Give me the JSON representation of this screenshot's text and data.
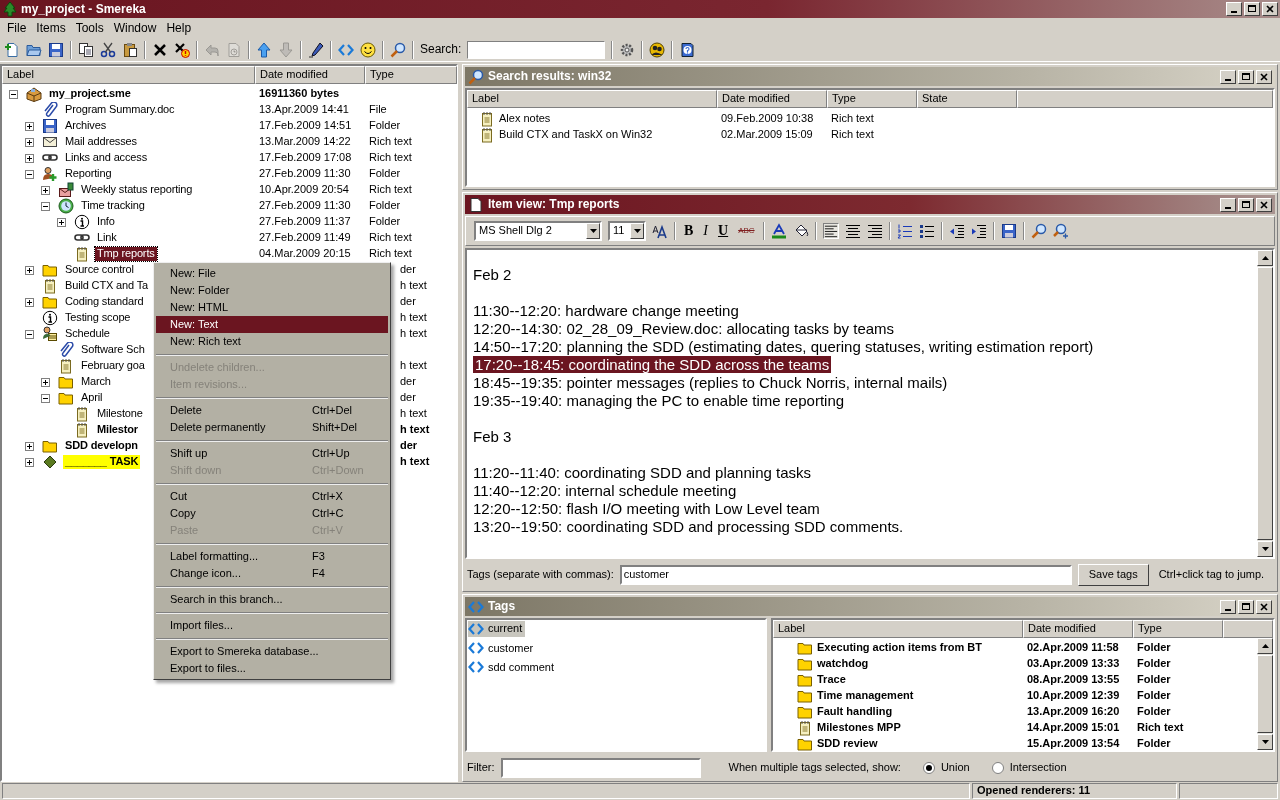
{
  "window": {
    "title": "my_project - Smereka"
  },
  "menu_bar": [
    "File",
    "Items",
    "Tools",
    "Window",
    "Help"
  ],
  "toolbar": [
    {
      "kind": "new",
      "disabled": false
    },
    {
      "kind": "open",
      "disabled": false
    },
    {
      "kind": "save",
      "disabled": false
    },
    {
      "kind": "separator"
    },
    {
      "kind": "copy",
      "disabled": false
    },
    {
      "kind": "cut",
      "disabled": false
    },
    {
      "kind": "paste",
      "disabled": false
    },
    {
      "kind": "separator"
    },
    {
      "kind": "delete",
      "disabled": false
    },
    {
      "kind": "delete_warn",
      "disabled": false
    },
    {
      "kind": "separator"
    },
    {
      "kind": "undo",
      "disabled": true
    },
    {
      "kind": "history",
      "disabled": true
    },
    {
      "kind": "separator"
    },
    {
      "kind": "up",
      "disabled": false
    },
    {
      "kind": "down",
      "disabled": true
    },
    {
      "kind": "separator"
    },
    {
      "kind": "pen",
      "disabled": false
    },
    {
      "kind": "separator"
    },
    {
      "kind": "tag",
      "disabled": false
    },
    {
      "kind": "smiley",
      "disabled": false
    },
    {
      "kind": "separator"
    },
    {
      "kind": "search",
      "disabled": false
    },
    {
      "kind": "separator"
    },
    {
      "kind": "search_box",
      "label": "Search:"
    },
    {
      "kind": "separator"
    },
    {
      "kind": "settings",
      "disabled": false
    },
    {
      "kind": "separator"
    },
    {
      "kind": "people",
      "disabled": false
    },
    {
      "kind": "separator"
    },
    {
      "kind": "help",
      "disabled": false
    }
  ],
  "tree": {
    "columns": [
      "Label",
      "Date modified",
      "Type"
    ],
    "nodes": [
      {
        "label": "my_project.sme",
        "date": "16911360 bytes",
        "kind": "package",
        "bold": true,
        "selected": false,
        "expanded": true,
        "children": [
          {
            "label": "Program Summary.doc",
            "date": "13.Apr.2009 14:41",
            "type": "File",
            "kind": "paperclip",
            "selected": false
          },
          {
            "label": "Archives",
            "date": "17.Feb.2009 14:51",
            "type": "Folder",
            "kind": "floppy",
            "selected": false,
            "expanded": false
          },
          {
            "label": "Mail addresses",
            "date": "13.Mar.2009 14:22",
            "type": "Rich text",
            "kind": "mail",
            "selected": false,
            "expanded": false
          },
          {
            "label": "Links and access",
            "date": "17.Feb.2009 17:08",
            "type": "Rich text",
            "kind": "link",
            "selected": false,
            "expanded": false
          },
          {
            "label": "Reporting",
            "date": "27.Feb.2009 11:30",
            "type": "Folder",
            "kind": "people",
            "selected": false,
            "expanded": true,
            "children": [
              {
                "label": "Weekly status reporting",
                "date": "10.Apr.2009 20:54",
                "type": "Rich text",
                "kind": "mailbox",
                "selected": false,
                "expanded": false
              },
              {
                "label": "Time tracking",
                "date": "27.Feb.2009 11:30",
                "type": "Folder",
                "kind": "clock",
                "selected": false,
                "expanded": true,
                "children": [
                  {
                    "label": "Info",
                    "date": "27.Feb.2009 11:37",
                    "type": "Folder",
                    "kind": "info",
                    "selected": false,
                    "expanded": false
                  },
                  {
                    "label": "Link",
                    "date": "27.Feb.2009 11:49",
                    "type": "Rich text",
                    "kind": "link",
                    "selected": false
                  },
                  {
                    "label": "Tmp reports",
                    "date": "04.Mar.2009 20:15",
                    "type": "Rich text",
                    "kind": "note",
                    "selected": true
                  }
                ]
              }
            ]
          },
          {
            "label": "Source control",
            "type": "der",
            "kind": "folder",
            "selected": false,
            "expanded": false
          },
          {
            "label": "Build CTX and Ta",
            "type": "h text",
            "kind": "note",
            "selected": false
          },
          {
            "label": "Coding standard",
            "type": "der",
            "kind": "folder",
            "selected": false,
            "expanded": false
          },
          {
            "label": "Testing scope",
            "type": "h text",
            "kind": "info",
            "selected": false
          },
          {
            "label": "Schedule",
            "type": "h text",
            "kind": "schedule",
            "selected": false,
            "expanded": true,
            "children": [
              {
                "label": "Software Sch",
                "kind": "paperclip",
                "selected": false
              },
              {
                "label": "February goa",
                "type": "h text",
                "kind": "note",
                "selected": false
              },
              {
                "label": "March",
                "type": "der",
                "kind": "folder",
                "selected": false,
                "expanded": false
              },
              {
                "label": "April",
                "type": "der",
                "kind": "folder",
                "selected": false,
                "expanded": true,
                "children": [
                  {
                    "label": "Milestone",
                    "type": "h text",
                    "kind": "note",
                    "selected": false
                  },
                  {
                    "label": "Milestor",
                    "type": "h text",
                    "kind": "note",
                    "bold": true,
                    "selected": false
                  }
                ]
              }
            ]
          },
          {
            "label": "SDD developn",
            "type": "der",
            "kind": "folder",
            "bold": true,
            "selected": false,
            "expanded": false
          },
          {
            "label": "_______ TASK",
            "type": "h text",
            "kind": "diamond",
            "bold": true,
            "highlighted": true,
            "selected": false,
            "expanded": false
          }
        ]
      }
    ]
  },
  "context_menu": [
    {
      "kind": "item",
      "label": "New: File",
      "disabled": false,
      "selected": false
    },
    {
      "kind": "item",
      "label": "New: Folder",
      "disabled": false,
      "selected": false
    },
    {
      "kind": "item",
      "label": "New: HTML",
      "disabled": false,
      "selected": false
    },
    {
      "kind": "item",
      "label": "New: Text",
      "disabled": false,
      "selected": true
    },
    {
      "kind": "item",
      "label": "New: Rich text",
      "disabled": false,
      "selected": false
    },
    {
      "kind": "separator"
    },
    {
      "kind": "item",
      "label": "Undelete children...",
      "disabled": true,
      "selected": false
    },
    {
      "kind": "item",
      "label": "Item revisions...",
      "disabled": true,
      "selected": false
    },
    {
      "kind": "separator"
    },
    {
      "kind": "item",
      "label": "Delete",
      "shortcut": "Ctrl+Del",
      "disabled": false,
      "selected": false
    },
    {
      "kind": "item",
      "label": "Delete permanently",
      "shortcut": "Shift+Del",
      "disabled": false,
      "selected": false
    },
    {
      "kind": "separator"
    },
    {
      "kind": "item",
      "label": "Shift up",
      "shortcut": "Ctrl+Up",
      "disabled": false,
      "selected": false
    },
    {
      "kind": "item",
      "label": "Shift down",
      "shortcut": "Ctrl+Down",
      "disabled": true,
      "selected": false
    },
    {
      "kind": "separator"
    },
    {
      "kind": "item",
      "label": "Cut",
      "shortcut": "Ctrl+X",
      "disabled": false,
      "selected": false
    },
    {
      "kind": "item",
      "label": "Copy",
      "shortcut": "Ctrl+C",
      "disabled": false,
      "selected": false
    },
    {
      "kind": "item",
      "label": "Paste",
      "shortcut": "Ctrl+V",
      "disabled": true,
      "selected": false
    },
    {
      "kind": "separator"
    },
    {
      "kind": "item",
      "label": "Label formatting...",
      "shortcut": "F3",
      "disabled": false,
      "selected": false
    },
    {
      "kind": "item",
      "label": "Change icon...",
      "shortcut": "F4",
      "disabled": false,
      "selected": false
    },
    {
      "kind": "separator"
    },
    {
      "kind": "item",
      "label": "Search in this branch...",
      "disabled": false,
      "selected": false
    },
    {
      "kind": "separator"
    },
    {
      "kind": "item",
      "label": "Import files...",
      "disabled": false,
      "selected": false
    },
    {
      "kind": "separator"
    },
    {
      "kind": "item",
      "label": "Export to Smereka database...",
      "disabled": false,
      "selected": false
    },
    {
      "kind": "item",
      "label": "Export to files...",
      "disabled": false,
      "selected": false
    }
  ],
  "search_results": {
    "title": "Search results: win32",
    "active": false,
    "columns": [
      "Label",
      "Date modified",
      "Type",
      "State"
    ],
    "rows": [
      {
        "label": "Alex notes",
        "date": "09.Feb.2009 10:38",
        "type": "Rich text"
      },
      {
        "label": "Build CTX and TaskX on Win32",
        "date": "02.Mar.2009 15:09",
        "type": "Rich text"
      }
    ]
  },
  "item_view": {
    "title": "Item view: Tmp reports",
    "active": true,
    "font": "MS Shell Dlg 2",
    "size": "11",
    "format_buttons": [
      {
        "kind": "font_size"
      },
      {
        "kind": "separator"
      },
      {
        "kind": "bold",
        "text": "B"
      },
      {
        "kind": "italic",
        "text": "I"
      },
      {
        "kind": "underline",
        "text": "U"
      },
      {
        "kind": "strike",
        "text": "ABC"
      },
      {
        "kind": "separator"
      },
      {
        "kind": "font_color"
      },
      {
        "kind": "fill"
      },
      {
        "kind": "separator"
      },
      {
        "kind": "align_left",
        "pressed": true
      },
      {
        "kind": "align_center",
        "pressed": false
      },
      {
        "kind": "align_right",
        "pressed": false
      },
      {
        "kind": "separator"
      },
      {
        "kind": "numbered"
      },
      {
        "kind": "bullets"
      },
      {
        "kind": "separator"
      },
      {
        "kind": "outdent"
      },
      {
        "kind": "indent"
      },
      {
        "kind": "separator"
      },
      {
        "kind": "save"
      },
      {
        "kind": "separator"
      },
      {
        "kind": "search"
      },
      {
        "kind": "zoom_in"
      }
    ],
    "lines": [
      {
        "kind": "heading",
        "text": "Feb 2",
        "selected": false
      },
      {
        "kind": "line",
        "text": "11:30--12:20: hardware change meeting",
        "selected": false
      },
      {
        "kind": "line",
        "text": "12:20--14:30: 02_28_09_Review.doc: allocating tasks by teams",
        "selected": false
      },
      {
        "kind": "line",
        "text": "14:50--17:20: planning the SDD (estimating dates, quering statuses, writing estimation report)",
        "selected": false
      },
      {
        "kind": "line",
        "text": "17:20--18:45: coordinating the SDD across the teams",
        "selected": true
      },
      {
        "kind": "line",
        "text": "18:45--19:35: pointer messages (replies to Chuck Norris, internal mails)",
        "selected": false
      },
      {
        "kind": "line",
        "text": "19:35--19:40: managing the PC to enable time reporting",
        "selected": false
      },
      {
        "kind": "heading",
        "text": "Feb 3",
        "selected": false
      },
      {
        "kind": "line",
        "text": "11:20--11:40: coordinating SDD and planning tasks",
        "selected": false
      },
      {
        "kind": "line",
        "text": "11:40--12:20: internal schedule meeting",
        "selected": false
      },
      {
        "kind": "line",
        "text": "12:20--12:50: flash I/O meeting with Low Level team",
        "selected": false
      },
      {
        "kind": "line",
        "text": "13:20--19:50: coordinating SDD and processing SDD comments.",
        "selected": false
      }
    ],
    "tags_label": "Tags (separate with commas):",
    "tags_value": "customer",
    "save_button": "Save tags",
    "hint": "Ctrl+click tag to jump."
  },
  "tags_panel": {
    "title": "Tags",
    "active": false,
    "tags": [
      {
        "label": "current",
        "selected": true
      },
      {
        "label": "customer",
        "selected": false
      },
      {
        "label": "sdd comment",
        "selected": false
      }
    ],
    "columns": [
      "Label",
      "Date modified",
      "Type"
    ],
    "rows": [
      {
        "label": "Executing action items from BT",
        "date": "02.Apr.2009 11:58",
        "type": "Folder",
        "kind": "folder"
      },
      {
        "label": "watchdog",
        "date": "03.Apr.2009 13:33",
        "type": "Folder",
        "kind": "folder"
      },
      {
        "label": "Trace",
        "date": "08.Apr.2009 13:55",
        "type": "Folder",
        "kind": "folder"
      },
      {
        "label": "Time management",
        "date": "10.Apr.2009 12:39",
        "type": "Folder",
        "kind": "folder"
      },
      {
        "label": "Fault handling",
        "date": "13.Apr.2009 16:20",
        "type": "Folder",
        "kind": "folder"
      },
      {
        "label": "Milestones MPP",
        "date": "14.Apr.2009 15:01",
        "type": "Rich text",
        "kind": "note"
      },
      {
        "label": "SDD review",
        "date": "15.Apr.2009 13:54",
        "type": "Folder",
        "kind": "folder"
      }
    ],
    "filter_label": "Filter:",
    "mode_label": "When multiple tags selected, show:",
    "modes": [
      {
        "label": "Union",
        "selected": true
      },
      {
        "label": "Intersection",
        "selected": false
      }
    ]
  },
  "status_bar": {
    "text": "Opened renderers: 11"
  }
}
